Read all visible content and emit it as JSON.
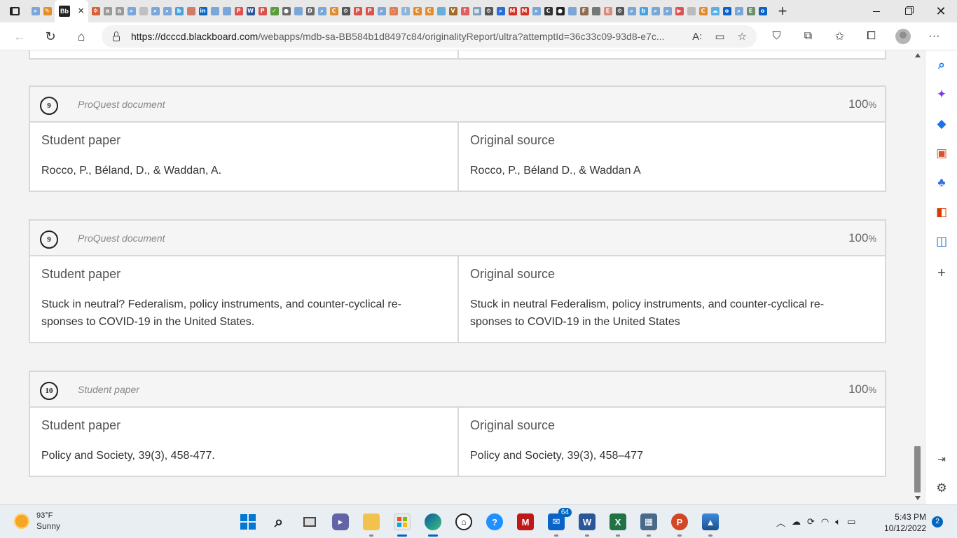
{
  "browser": {
    "active_tab": {
      "favicon_text": "Bb",
      "close_glyph": "×"
    },
    "favicon_strip": [
      {
        "icon": "search-icon",
        "color": "#7aa7d8",
        "glyph": "⌕"
      },
      {
        "icon": "notes-icon",
        "color": "#e58f2a",
        "glyph": "✎"
      },
      {
        "icon": "puzzle-icon",
        "color": "#d5623a",
        "glyph": "✲"
      },
      {
        "icon": "amazon-icon",
        "color": "#9a9a9a",
        "glyph": "a"
      },
      {
        "icon": "amazon-icon",
        "color": "#9a9a9a",
        "glyph": "a"
      },
      {
        "icon": "search-icon",
        "color": "#7aa7d8",
        "glyph": "⌕"
      },
      {
        "icon": "page-icon",
        "color": "#c0c0c0",
        "glyph": ""
      },
      {
        "icon": "search-icon",
        "color": "#7aa7d8",
        "glyph": "⌕"
      },
      {
        "icon": "search-icon",
        "color": "#7aa7d8",
        "glyph": "⌕"
      },
      {
        "icon": "bing-icon",
        "color": "#4aa3df",
        "glyph": "b"
      },
      {
        "icon": "shield-icon",
        "color": "#d17c6b",
        "glyph": ""
      },
      {
        "icon": "linkedin-icon",
        "color": "#0a66c2",
        "glyph": "in"
      },
      {
        "icon": "globe-icon",
        "color": "#7aa7d8",
        "glyph": ""
      },
      {
        "icon": "globe-icon",
        "color": "#7aa7d8",
        "glyph": ""
      },
      {
        "icon": "pdf-icon",
        "color": "#d9534f",
        "glyph": "P"
      },
      {
        "icon": "word-icon",
        "color": "#2b579a",
        "glyph": "W"
      },
      {
        "icon": "pdf-icon",
        "color": "#d9534f",
        "glyph": "P"
      },
      {
        "icon": "check-icon",
        "color": "#5a9e3a",
        "glyph": "✓"
      },
      {
        "icon": "record-icon",
        "color": "#6b6b6b",
        "glyph": "●"
      },
      {
        "icon": "globe-icon",
        "color": "#7aa7d8",
        "glyph": ""
      },
      {
        "icon": "d-icon",
        "color": "#6a6a6a",
        "glyph": "D"
      },
      {
        "icon": "search-icon",
        "color": "#7aa7d8",
        "glyph": "⌕"
      },
      {
        "icon": "c-icon",
        "color": "#e38c2d",
        "glyph": "C"
      },
      {
        "icon": "gear-icon",
        "color": "#555555",
        "glyph": "⚙"
      },
      {
        "icon": "pdf-icon",
        "color": "#d9534f",
        "glyph": "P"
      },
      {
        "icon": "pdf-icon",
        "color": "#d9534f",
        "glyph": "P"
      },
      {
        "icon": "search-icon",
        "color": "#7aa7d8",
        "glyph": "⌕"
      },
      {
        "icon": "loading-icon",
        "color": "#e07b53",
        "glyph": "◌"
      },
      {
        "icon": "info-icon",
        "color": "#8fb3d9",
        "glyph": "i"
      },
      {
        "icon": "c-icon",
        "color": "#e38c2d",
        "glyph": "C"
      },
      {
        "icon": "c-icon",
        "color": "#e38c2d",
        "glyph": "C"
      },
      {
        "icon": "globe-icon",
        "color": "#6aaed6",
        "glyph": ""
      },
      {
        "icon": "vs-icon",
        "color": "#a36a2a",
        "glyph": "V"
      },
      {
        "icon": "arrow-icon",
        "color": "#e06060",
        "glyph": "↑"
      },
      {
        "icon": "grid-icon",
        "color": "#7e9fc0",
        "glyph": "▦"
      },
      {
        "icon": "gear-icon",
        "color": "#555555",
        "glyph": "⚙"
      },
      {
        "icon": "search-icon",
        "color": "#2a6fd6",
        "glyph": "⌕"
      },
      {
        "icon": "gmail-icon",
        "color": "#d93025",
        "glyph": "M"
      },
      {
        "icon": "gmail-icon",
        "color": "#d93025",
        "glyph": "M"
      },
      {
        "icon": "search-icon",
        "color": "#7aa7d8",
        "glyph": "⌕"
      },
      {
        "icon": "c-icon",
        "color": "#333333",
        "glyph": "C"
      },
      {
        "icon": "record-icon",
        "color": "#222222",
        "glyph": "●"
      },
      {
        "icon": "globe-icon",
        "color": "#7aa7d8",
        "glyph": ""
      },
      {
        "icon": "f-icon",
        "color": "#8e6d4e",
        "glyph": "F"
      },
      {
        "icon": "globe-icon",
        "color": "#777777",
        "glyph": ""
      },
      {
        "icon": "e-icon",
        "color": "#d98c7a",
        "glyph": "E"
      },
      {
        "icon": "gear-icon",
        "color": "#555555",
        "glyph": "⚙"
      },
      {
        "icon": "search-icon",
        "color": "#7aa7d8",
        "glyph": "⌕"
      },
      {
        "icon": "bing-icon",
        "color": "#4aa3df",
        "glyph": "b"
      },
      {
        "icon": "search-icon",
        "color": "#7aa7d8",
        "glyph": "⌕"
      },
      {
        "icon": "search-icon",
        "color": "#7aa7d8",
        "glyph": "⌕"
      },
      {
        "icon": "video-icon",
        "color": "#e05050",
        "glyph": "▶"
      },
      {
        "icon": "page-icon",
        "color": "#bbbbbb",
        "glyph": ""
      },
      {
        "icon": "c-icon",
        "color": "#e38c2d",
        "glyph": "C"
      },
      {
        "icon": "cloud-icon",
        "color": "#5ab0e8",
        "glyph": "☁"
      },
      {
        "icon": "outlook-icon",
        "color": "#0a64c8",
        "glyph": "o"
      },
      {
        "icon": "search-icon",
        "color": "#7aa7d8",
        "glyph": "⌕"
      },
      {
        "icon": "es-icon",
        "color": "#6b8e6b",
        "glyph": "E"
      },
      {
        "icon": "outlook-icon",
        "color": "#0a64c8",
        "glyph": "o"
      }
    ],
    "new_tab_glyph": "+",
    "url_host": "https://dcccd.blackboard.com",
    "url_rest": "/webapps/mdb-sa-BB584b1d8497c84/originalityReport/ultra?attemptId=36c33c09-93d8-e7c..."
  },
  "report": {
    "cards": [
      {
        "number": "9",
        "source": "ProQuest document",
        "percent": "100",
        "percent_symbol": "%",
        "left_title": "Student paper",
        "left_text": "Rocco, P., Béland, D., & Waddan, A.",
        "right_title": "Original source",
        "right_text": "Rocco, P., Béland D., & Waddan A"
      },
      {
        "number": "9",
        "source": "ProQuest document",
        "percent": "100",
        "percent_symbol": "%",
        "left_title": "Student paper",
        "left_text": "Stuck in neutral? Federalism, policy instruments, and counter-cyclical re-sponses to COVID-19 in the United States.",
        "right_title": "Original source",
        "right_text": "Stuck in neutral Federalism, policy instruments, and counter-cyclical re-sponses to COVID-19 in the United States"
      },
      {
        "number": "10",
        "source": "Student paper",
        "percent": "100",
        "percent_symbol": "%",
        "left_title": "Student paper",
        "left_text": "Policy and Society, 39(3), 458-477.",
        "right_title": "Original source",
        "right_text": "Policy and Society, 39(3), 458–477"
      }
    ]
  },
  "taskbar": {
    "weather": {
      "temp": "93°F",
      "condition": "Sunny"
    },
    "mail_badge": "64",
    "clock_time": "5:43 PM",
    "clock_date": "10/12/2022",
    "notification_count": "2"
  }
}
